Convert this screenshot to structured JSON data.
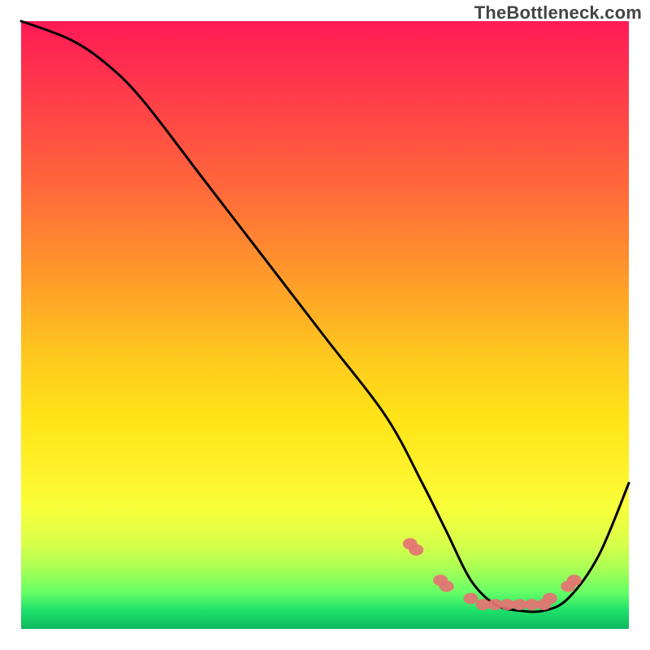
{
  "watermark": "TheBottleneck.com",
  "chart_data": {
    "type": "line",
    "title": "",
    "xlabel": "",
    "ylabel": "",
    "xlim": [
      0,
      100
    ],
    "ylim": [
      0,
      100
    ],
    "legend": false,
    "grid": false,
    "series": [
      {
        "name": "bottleneck-curve",
        "x": [
          0,
          8,
          14,
          20,
          30,
          40,
          50,
          60,
          66,
          70,
          74,
          78,
          82,
          86,
          90,
          95,
          100
        ],
        "values": [
          100,
          97,
          93,
          87,
          74,
          61,
          48,
          35,
          24,
          16,
          8,
          4,
          3,
          3,
          5,
          12,
          24
        ]
      }
    ],
    "markers": {
      "name": "highlight-beads",
      "x": [
        64,
        65,
        69,
        70,
        74,
        76,
        78,
        80,
        82,
        84,
        86,
        87,
        90,
        91
      ],
      "values": [
        14,
        13,
        8,
        7,
        5,
        4,
        4,
        4,
        4,
        4,
        4,
        5,
        7,
        8
      ]
    },
    "background_gradient": {
      "top_color": "#ff1a55",
      "mid_color": "#ffe318",
      "bottom_color": "#0fb85f"
    }
  }
}
